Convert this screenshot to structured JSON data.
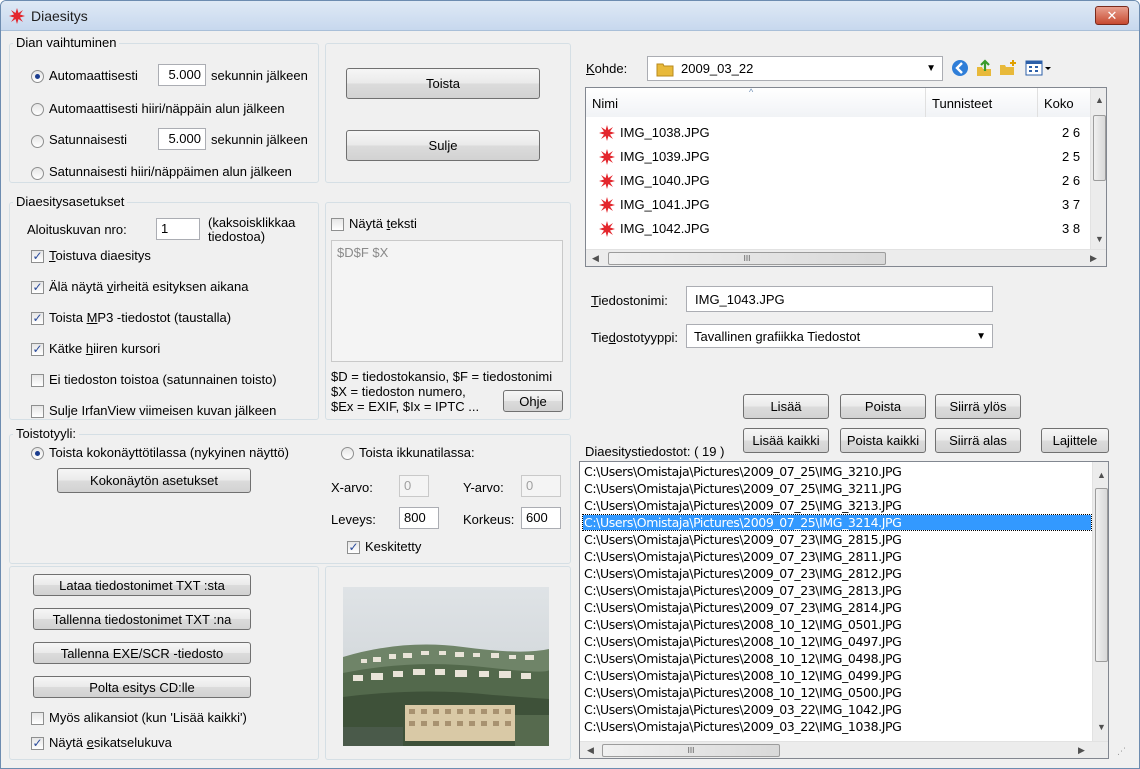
{
  "window": {
    "title": "Diaesitys",
    "close_glyph": "✕"
  },
  "change": {
    "legend": "Dian vaihtuminen",
    "auto_time_pre": "Automaattisesti",
    "auto_time_value": "5.000",
    "auto_time_post": "sekunnin jälkeen",
    "auto_key": "Automaattisesti hiiri/näppäin alun jälkeen",
    "random_time_pre": "Satunnaisesti",
    "random_time_value": "5.000",
    "random_time_post": "sekunnin jälkeen",
    "random_key": "Satunnaisesti hiiri/näppäimen alun jälkeen",
    "selected": 0
  },
  "play_button": "Toista",
  "close_button": "Sulje",
  "settings": {
    "legend": "Diaesitysasetukset",
    "start_label": "Aloituskuvan nro:",
    "start_value": "1",
    "start_hint": "(kaksoisklikkaa tiedostoa)",
    "options": [
      {
        "label": "Toistuva diaesitys",
        "checked": true
      },
      {
        "label": "Älä näytä virheitä esityksen aikana",
        "checked": true
      },
      {
        "label": "Toista MP3 -tiedostot (taustalla)",
        "checked": true
      },
      {
        "label": "Kätke hiiren kursori",
        "checked": true
      },
      {
        "label": "Ei tiedoston toistoa (satunnainen toisto)",
        "checked": false
      },
      {
        "label": "Sulje IrfanView viimeisen kuvan jälkeen",
        "checked": false
      }
    ],
    "show_text_label": "Näytä teksti",
    "show_text_checked": false,
    "text_value": "$D$F $X",
    "help_1": "$D = tiedostokansio, $F = tiedostonimi",
    "help_2": "$X = tiedoston numero,",
    "help_3": "$Ex = EXIF, $Ix = IPTC ...",
    "help_button": "Ohje"
  },
  "playstyle": {
    "legend": "Toistotyyli:",
    "fullscreen_label": "Toista kokonäyttötilassa (nykyinen näyttö)",
    "fullscreen_selected": true,
    "fullscreen_settings_button": "Kokonäytön asetukset",
    "window_label": "Toista ikkunatilassa:",
    "window_selected": false,
    "x_label": "X-arvo:",
    "x_value": "0",
    "y_label": "Y-arvo:",
    "y_value": "0",
    "width_label": "Leveys:",
    "width_value": "800",
    "height_label": "Korkeus:",
    "height_value": "600",
    "center_label": "Keskitetty",
    "center_checked": true
  },
  "bottom_left": {
    "load_txt": "Lataa tiedostonimet TXT :sta",
    "save_txt": "Tallenna tiedostonimet TXT :na",
    "save_exe": "Tallenna  EXE/SCR -tiedosto",
    "burn_cd": "Polta esitys CD:lle",
    "subfolders_label": "Myös alikansiot (kun 'Lisää kaikki')",
    "subfolders_checked": false,
    "preview_label": "Näytä esikatselukuva",
    "preview_checked": true
  },
  "browser": {
    "look_in_label": "Kohde:",
    "folder": "2009_03_22",
    "columns": [
      "Nimi",
      "Tunnisteet",
      "Koko"
    ],
    "files": [
      {
        "name": "IMG_1038.JPG",
        "size": "2 6"
      },
      {
        "name": "IMG_1039.JPG",
        "size": "2 5"
      },
      {
        "name": "IMG_1040.JPG",
        "size": "2 6"
      },
      {
        "name": "IMG_1041.JPG",
        "size": "3 7"
      },
      {
        "name": "IMG_1042.JPG",
        "size": "3 8"
      }
    ],
    "hscroll_glyph": "III",
    "filename_label": "Tiedostonimi:",
    "filename_value": "IMG_1043.JPG",
    "filetype_label": "Tiedostotyyppi:",
    "filetype_value": "Tavallinen grafiikka Tiedostot"
  },
  "list_buttons": {
    "add": "Lisää",
    "remove": "Poista",
    "move_up": "Siirrä ylös",
    "add_all": "Lisää kaikki",
    "remove_all": "Poista kaikki",
    "move_down": "Siirrä alas",
    "sort": "Lajittele"
  },
  "slideshow_files": {
    "label": "Diaesitystiedostot: ( 19 )",
    "selected_index": 3,
    "items": [
      "C:\\Users\\Omistaja\\Pictures\\2009_07_25\\IMG_3210.JPG",
      "C:\\Users\\Omistaja\\Pictures\\2009_07_25\\IMG_3211.JPG",
      "C:\\Users\\Omistaja\\Pictures\\2009_07_25\\IMG_3213.JPG",
      "C:\\Users\\Omistaja\\Pictures\\2009_07_25\\IMG_3214.JPG",
      "C:\\Users\\Omistaja\\Pictures\\2009_07_23\\IMG_2815.JPG",
      "C:\\Users\\Omistaja\\Pictures\\2009_07_23\\IMG_2811.JPG",
      "C:\\Users\\Omistaja\\Pictures\\2009_07_23\\IMG_2812.JPG",
      "C:\\Users\\Omistaja\\Pictures\\2009_07_23\\IMG_2813.JPG",
      "C:\\Users\\Omistaja\\Pictures\\2009_07_23\\IMG_2814.JPG",
      "C:\\Users\\Omistaja\\Pictures\\2008_10_12\\IMG_0501.JPG",
      "C:\\Users\\Omistaja\\Pictures\\2008_10_12\\IMG_0497.JPG",
      "C:\\Users\\Omistaja\\Pictures\\2008_10_12\\IMG_0498.JPG",
      "C:\\Users\\Omistaja\\Pictures\\2008_10_12\\IMG_0499.JPG",
      "C:\\Users\\Omistaja\\Pictures\\2008_10_12\\IMG_0500.JPG",
      "C:\\Users\\Omistaja\\Pictures\\2009_03_22\\IMG_1042.JPG",
      "C:\\Users\\Omistaja\\Pictures\\2009_03_22\\IMG_1038.JPG"
    ],
    "hscroll_glyph": "III"
  },
  "colors": {
    "selection": "#3399ff",
    "icon_red": "#e3262d",
    "folder_yellow": "#e8b93a"
  },
  "icons": [
    "irfanview-splat-icon",
    "folder-icon",
    "back-icon",
    "up-folder-icon",
    "new-folder-icon",
    "view-menu-icon"
  ]
}
